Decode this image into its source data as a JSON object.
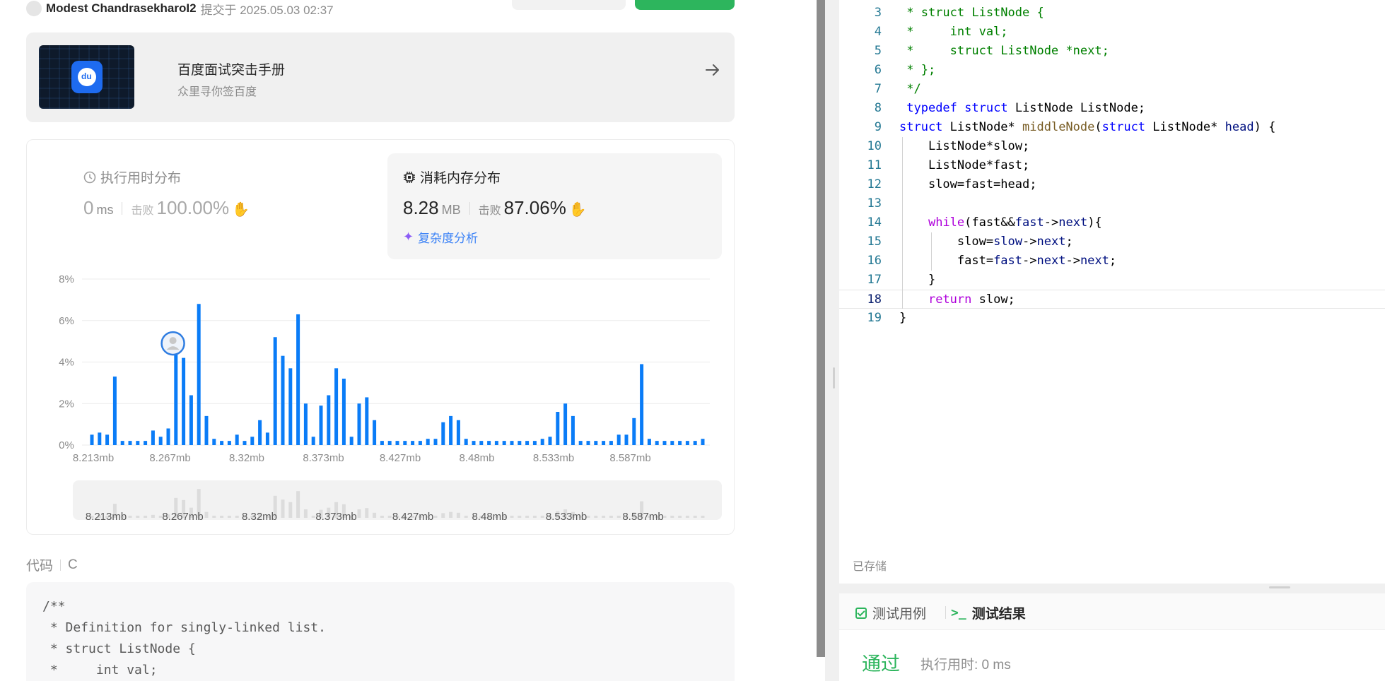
{
  "header": {
    "username": "Modest ChandrasekharoI2",
    "submitted_text": "提交于 2025.05.03 02:37"
  },
  "ad": {
    "title": "百度面试突击手册",
    "subtitle": "众里寻你签百度"
  },
  "runtime": {
    "title": "执行用时分布",
    "value": "0",
    "unit": "ms",
    "beat_label": "击败",
    "beat_value": "100.00%"
  },
  "memory": {
    "title": "消耗内存分布",
    "value": "8.28",
    "unit": "MB",
    "beat_label": "击败",
    "beat_value": "87.06%",
    "complexity_link": "复杂度分析"
  },
  "chart_data": {
    "type": "bar",
    "ylim": [
      0,
      8
    ],
    "y_ticks": [
      "0%",
      "2%",
      "4%",
      "6%",
      "8%"
    ],
    "x_tick_labels": [
      "8.213mb",
      "8.267mb",
      "8.32mb",
      "8.373mb",
      "8.427mb",
      "8.48mb",
      "8.533mb",
      "8.587mb"
    ],
    "grid": true,
    "values": [
      0.5,
      0.6,
      0.5,
      3.3,
      0.2,
      0.2,
      0.2,
      0.2,
      0.7,
      0.4,
      0.8,
      4.7,
      4.2,
      2.4,
      6.8,
      1.4,
      0.3,
      0.2,
      0.2,
      0.5,
      0.2,
      0.4,
      1.2,
      0.6,
      5.2,
      4.3,
      3.7,
      6.3,
      2.0,
      0.4,
      1.9,
      2.4,
      3.7,
      3.2,
      0.4,
      2.0,
      2.3,
      1.2,
      0.2,
      0.2,
      0.2,
      0.2,
      0.2,
      0.2,
      0.3,
      0.3,
      1.1,
      1.4,
      1.2,
      0.3,
      0.2,
      0.2,
      0.2,
      0.2,
      0.2,
      0.2,
      0.2,
      0.2,
      0.2,
      0.3,
      0.4,
      1.6,
      2.0,
      1.4,
      0.2,
      0.2,
      0.2,
      0.2,
      0.2,
      0.5,
      0.5,
      1.3,
      3.9,
      0.3,
      0.2,
      0.2,
      0.2,
      0.2,
      0.2,
      0.2,
      0.3
    ],
    "highlight_index": 12
  },
  "code_section": {
    "label": "代码",
    "language": "C",
    "lines": [
      "/**",
      " * Definition for singly-linked list.",
      " * struct ListNode {",
      " *     int val;"
    ]
  },
  "editor": {
    "saved_label": "已存储",
    "active_line": 18
  },
  "tabs": {
    "test_case": "测试用例",
    "test_result": "测试结果"
  },
  "result": {
    "status": "通过",
    "exec_time": "执行用时: 0 ms"
  },
  "colors": {
    "bar": "#0a7cf7",
    "accent_green": "#2db55d",
    "link_blue": "#3b82f6"
  }
}
